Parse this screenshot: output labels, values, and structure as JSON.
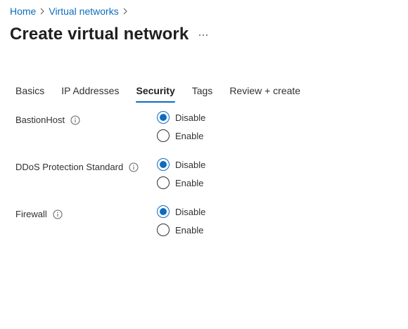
{
  "breadcrumb": {
    "items": [
      {
        "label": "Home"
      },
      {
        "label": "Virtual networks"
      }
    ]
  },
  "header": {
    "title": "Create virtual network",
    "more_icon": "ellipsis-icon"
  },
  "tabs": [
    {
      "label": "Basics",
      "active": false
    },
    {
      "label": "IP Addresses",
      "active": false
    },
    {
      "label": "Security",
      "active": true
    },
    {
      "label": "Tags",
      "active": false
    },
    {
      "label": "Review + create",
      "active": false
    }
  ],
  "security": {
    "fields": [
      {
        "label": "BastionHost",
        "icon": "info-icon",
        "options": [
          {
            "label": "Disable",
            "selected": true
          },
          {
            "label": "Enable",
            "selected": false
          }
        ]
      },
      {
        "label": "DDoS Protection Standard",
        "icon": "info-icon",
        "options": [
          {
            "label": "Disable",
            "selected": true
          },
          {
            "label": "Enable",
            "selected": false
          }
        ]
      },
      {
        "label": "Firewall",
        "icon": "info-icon",
        "options": [
          {
            "label": "Disable",
            "selected": true
          },
          {
            "label": "Enable",
            "selected": false
          }
        ]
      }
    ]
  },
  "colors": {
    "accent": "#0f6cbd",
    "text": "#323130",
    "title": "#201f1e"
  }
}
